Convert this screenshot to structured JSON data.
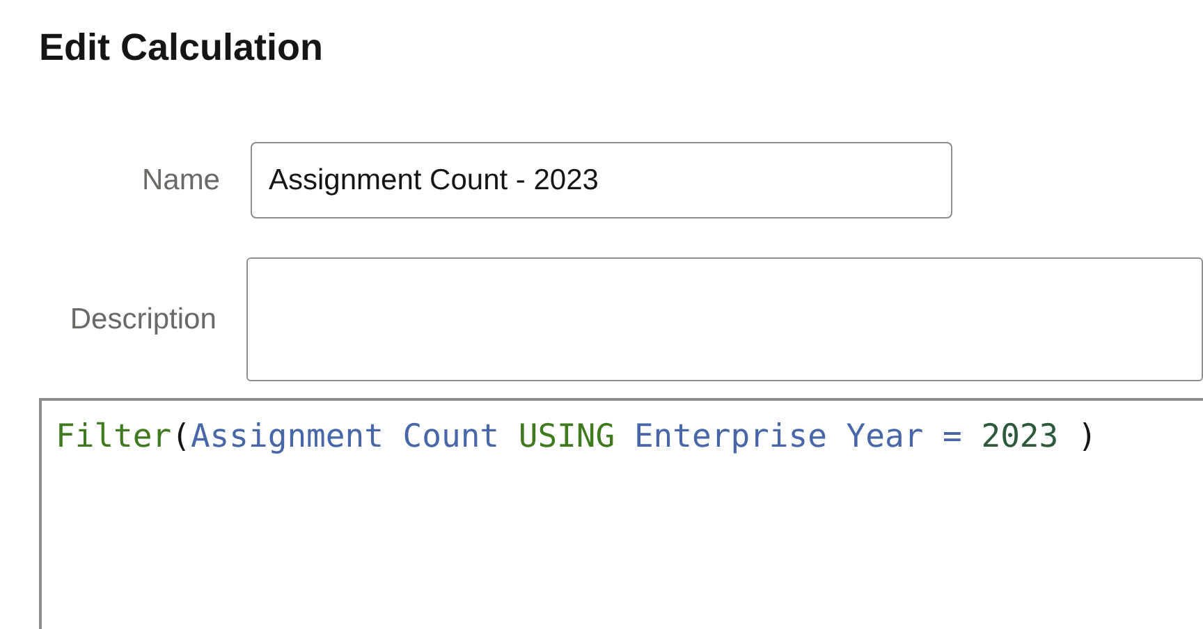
{
  "title": "Edit Calculation",
  "fields": [
    {
      "label": "Name",
      "value": "Assignment Count - 2023",
      "kind": "input"
    },
    {
      "label": "Description",
      "kind": "textarea"
    }
  ],
  "expression": [
    {
      "text": "Filter",
      "kind": "function"
    },
    {
      "text": "(",
      "kind": "punct"
    },
    {
      "text": "Assignment Count ",
      "kind": "column"
    },
    {
      "text": "USING ",
      "kind": "keyword"
    },
    {
      "text": "Enterprise Year ",
      "kind": "column"
    },
    {
      "text": "= ",
      "kind": "operator"
    },
    {
      "text": "2023 ",
      "kind": "number"
    },
    {
      "text": ")",
      "kind": "punct"
    }
  ]
}
